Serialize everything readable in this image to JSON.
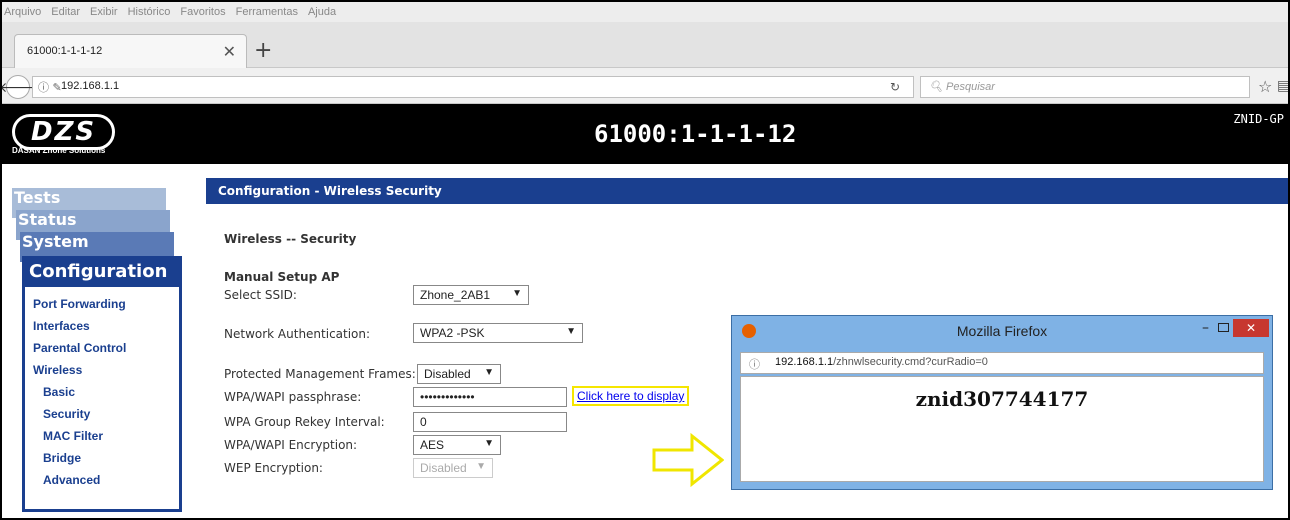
{
  "browser": {
    "menu": [
      "Arquivo",
      "Editar",
      "Exibir",
      "Histórico",
      "Favoritos",
      "Ferramentas",
      "Ajuda"
    ],
    "tab_title": "61000:1-1-1-12",
    "url": "192.168.1.1",
    "search_placeholder": "Pesquisar"
  },
  "header": {
    "logo": "DZS",
    "logo_sub": "DASAN Zhone Solutions",
    "title": "61000:1-1-1-12",
    "model": "ZNID-GP"
  },
  "sidebar": {
    "tabs": [
      "Tests",
      "Status",
      "System"
    ],
    "active": "Configuration",
    "items": [
      {
        "label": "Port Forwarding"
      },
      {
        "label": "Interfaces"
      },
      {
        "label": "Parental Control"
      },
      {
        "label": "Wireless"
      },
      {
        "label": "Basic"
      },
      {
        "label": "Security"
      },
      {
        "label": "MAC Filter"
      },
      {
        "label": "Bridge"
      },
      {
        "label": "Advanced"
      }
    ]
  },
  "content": {
    "section_title": "Configuration - Wireless Security",
    "subtitle": "Wireless -- Security",
    "manual_setup": "Manual Setup AP",
    "fields": {
      "ssid_label": "Select SSID:",
      "ssid_value": "Zhone_2AB1",
      "auth_label": "Network Authentication:",
      "auth_value": "WPA2 -PSK",
      "pmf_label": "Protected Management Frames:",
      "pmf_value": "Disabled",
      "passphrase_label": "WPA/WAPI passphrase:",
      "passphrase_value": "•••••••••••••",
      "display_link": "Click here to display",
      "rekey_label": "WPA Group Rekey Interval:",
      "rekey_value": "0",
      "encryption_label": "WPA/WAPI Encryption:",
      "encryption_value": "AES",
      "wep_label": "WEP Encryption:",
      "wep_value": "Disabled"
    }
  },
  "popup": {
    "title": "Mozilla Firefox",
    "url_host": "192.168.1.1",
    "url_path": "/zhnwlsecurity.cmd?curRadio=0",
    "password": "znid307744177"
  }
}
